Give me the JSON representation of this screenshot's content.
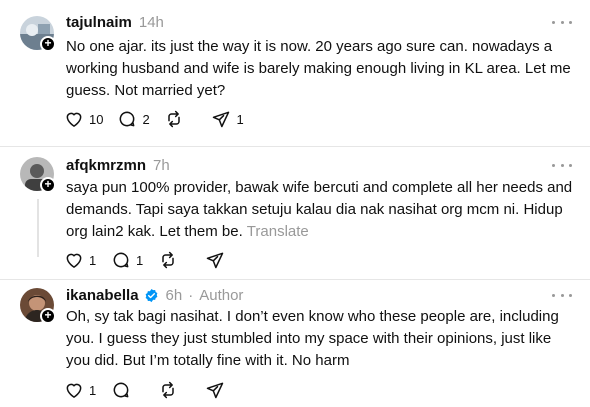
{
  "posts": [
    {
      "username": "tajulnaim",
      "time": "14h",
      "text": "No one ajar. its just the way it is now. 20 years ago sure can. nowadays a working husband and wife is barely making enough living in KL area. Let me guess. Not married yet?",
      "likes": "10",
      "replies": "2",
      "reposts": "",
      "shares": "1"
    },
    {
      "username": "afqkmrzmn",
      "time": "7h",
      "text": "saya pun 100% provider, bawak wife bercuti and complete all her needs and demands. Tapi saya takkan setuju kalau dia nak nasihat org mcm ni. Hidup org lain2 kak. Let them be.",
      "translate": "Translate",
      "likes": "1",
      "replies": "1",
      "reposts": "",
      "shares": ""
    },
    {
      "username": "ikanabella",
      "time": "6h",
      "author_tag": "Author",
      "text": "Oh, sy tak bagi nasihat. I don’t even know who these people are, including you. I guess they just stumbled into my space with their opinions, just like you did. But I’m totally fine with it. No harm",
      "likes": "1",
      "replies": "",
      "reposts": "",
      "shares": ""
    }
  ]
}
